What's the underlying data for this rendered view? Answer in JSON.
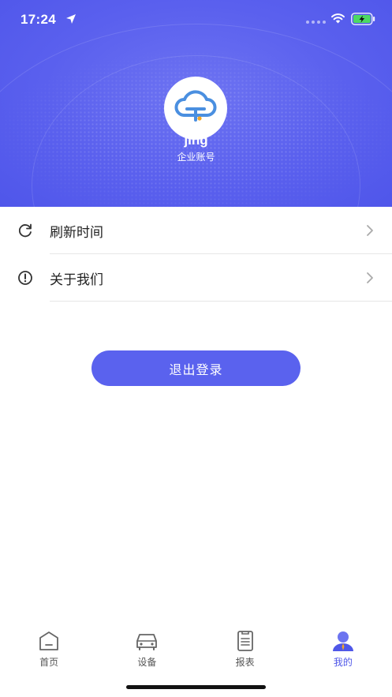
{
  "status_bar": {
    "time": "17:24"
  },
  "profile": {
    "username": "jing",
    "account_type": "企业账号",
    "avatar_icon": "cloud-logo-icon"
  },
  "menu": {
    "items": [
      {
        "label": "刷新时间",
        "icon": "refresh-icon"
      },
      {
        "label": "关于我们",
        "icon": "info-icon"
      }
    ]
  },
  "logout": {
    "label": "退出登录"
  },
  "tab_bar": {
    "tabs": [
      {
        "label": "首页",
        "icon": "home-icon"
      },
      {
        "label": "设备",
        "icon": "car-icon"
      },
      {
        "label": "报表",
        "icon": "report-icon"
      },
      {
        "label": "我的",
        "icon": "user-icon",
        "active": true
      }
    ]
  },
  "colors": {
    "brand": "#5a62ee",
    "active_tab": "#4f57e8",
    "battery": "#4cd964"
  }
}
